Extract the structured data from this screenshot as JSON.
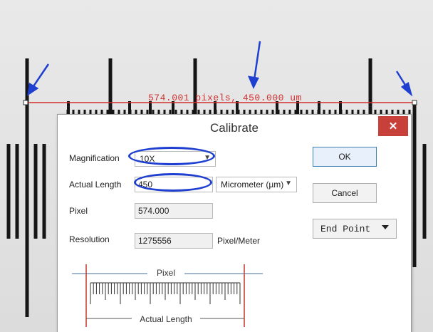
{
  "measurement": {
    "overlay_text": "574.001 pixels, 450.000 um",
    "line_color": "#d03030"
  },
  "annotation_color": "#1f3fd1",
  "dialog": {
    "title": "Calibrate",
    "close_glyph": "✕",
    "magnification": {
      "label": "Magnification",
      "value": "10X"
    },
    "actual_length": {
      "label": "Actual Length",
      "value": "450",
      "unit": "Micrometer (µm)"
    },
    "pixel": {
      "label": "Pixel",
      "value": "574.000"
    },
    "resolution": {
      "label": "Resolution",
      "value": "1275556",
      "unit": "Pixel/Meter"
    },
    "buttons": {
      "ok": "OK",
      "cancel": "Cancel",
      "end_point": "End Point"
    },
    "diagram": {
      "top_label": "Pixel",
      "bottom_label": "Actual Length"
    }
  }
}
